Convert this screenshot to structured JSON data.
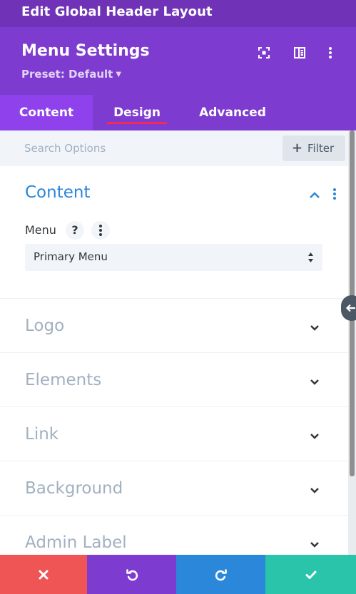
{
  "window": {
    "title": "Edit Global Header Layout"
  },
  "header": {
    "module_title": "Menu Settings",
    "preset_label": "Preset: Default",
    "icons": [
      "expand-icon",
      "sidebar-layout-icon",
      "more-vertical-icon"
    ]
  },
  "tabs": [
    {
      "label": "Content",
      "state": "current"
    },
    {
      "label": "Design",
      "state": "hover-underlined"
    },
    {
      "label": "Advanced",
      "state": ""
    }
  ],
  "search": {
    "placeholder": "Search Options",
    "filter_label": "Filter"
  },
  "sections": {
    "content": {
      "title": "Content",
      "expanded": true,
      "field": {
        "label": "Menu",
        "help": "?",
        "selected": "Primary Menu"
      }
    },
    "collapsed": [
      {
        "title": "Logo"
      },
      {
        "title": "Elements"
      },
      {
        "title": "Link"
      },
      {
        "title": "Background"
      },
      {
        "title": "Admin Label"
      }
    ]
  },
  "bottom_bar": {
    "buttons": [
      "discard-icon",
      "undo-icon",
      "redo-icon",
      "save-check-icon"
    ]
  },
  "colors": {
    "title_strip": "#7033b7",
    "header": "#7e3bd0",
    "active_tab": "#8f42ec",
    "tab_underline": "#ef2c55",
    "accent_blue": "#2b87da",
    "discard_red": "#ef5555",
    "save_green": "#29c4a9"
  }
}
